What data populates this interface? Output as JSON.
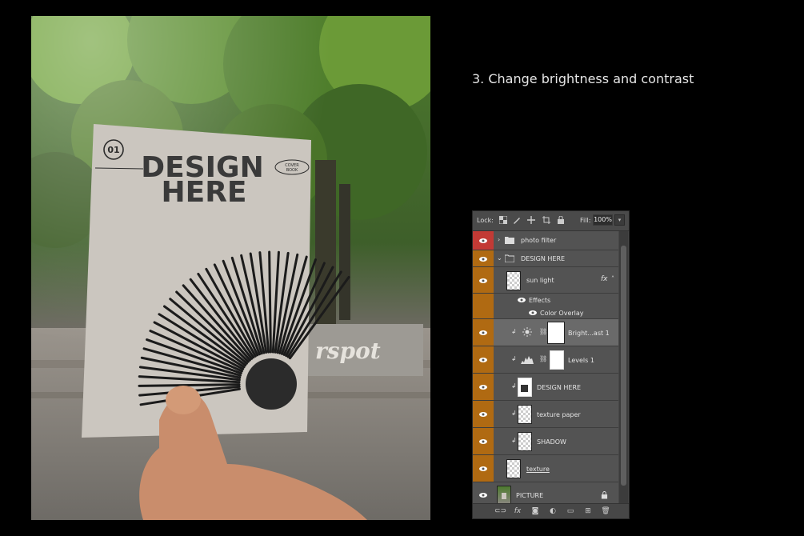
{
  "instruction": "3. Change brightness and contrast",
  "mockup": {
    "badge": "01",
    "headline_line1": "DESIGN",
    "headline_line2": "HERE",
    "tag_line1": "COVER",
    "tag_line2": "BOOK",
    "sign_text": "rspot"
  },
  "panel": {
    "lock_label": "Lock:",
    "fill_label": "Fill:",
    "fill_value": "100%",
    "layers": [
      {
        "name": "photo filter",
        "kind": "group",
        "expanded": false
      },
      {
        "name": "DESIGN HERE",
        "kind": "group",
        "expanded": true
      },
      {
        "name": "sun light",
        "kind": "layer",
        "fx": "fx"
      },
      {
        "name": "Effects",
        "kind": "effects"
      },
      {
        "name": "Color Overlay",
        "kind": "effect"
      },
      {
        "name": "Bright...ast 1",
        "kind": "adjustment"
      },
      {
        "name": "Levels 1",
        "kind": "adjustment"
      },
      {
        "name": "DESIGN HERE",
        "kind": "smart"
      },
      {
        "name": "texture paper",
        "kind": "layer"
      },
      {
        "name": "SHADOW",
        "kind": "layer"
      },
      {
        "name": "texture",
        "kind": "layer"
      },
      {
        "name": "PICTURE",
        "kind": "background"
      }
    ]
  },
  "colors": {
    "group_orange": "#b06a12",
    "visibility_red": "#c23a35",
    "panel_bg": "#535353",
    "selected_row": "#6a6a6a"
  }
}
